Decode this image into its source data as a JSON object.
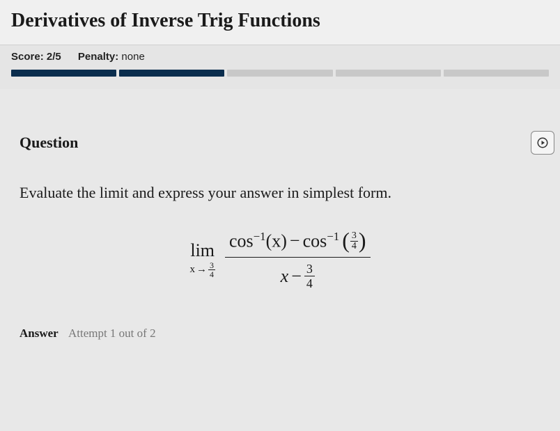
{
  "page_title": "Derivatives of Inverse Trig Functions",
  "score": {
    "label": "Score:",
    "value": "2/5",
    "penalty_label": "Penalty:",
    "penalty_value": "none",
    "segments_total": 5,
    "segments_filled": 2
  },
  "question": {
    "label": "Question",
    "prompt": "Evaluate the limit and express your answer in simplest form.",
    "math": {
      "lim_text": "lim",
      "lim_var": "x",
      "lim_arrow": "→",
      "lim_to_num": "3",
      "lim_to_den": "4",
      "numer_a": "cos",
      "numer_a_sup": "−1",
      "numer_a_arg": "(x)",
      "minus": "−",
      "numer_b": "cos",
      "numer_b_sup": "−1",
      "paren_l": "(",
      "paren_r": ")",
      "frac_small_num": "3",
      "frac_small_den": "4",
      "denom_x": "x",
      "denom_minus": "−",
      "denom_frac_num": "3",
      "denom_frac_den": "4"
    }
  },
  "answer": {
    "label": "Answer",
    "attempt": "Attempt 1 out of 2"
  },
  "icons": {
    "video": "video-icon"
  }
}
